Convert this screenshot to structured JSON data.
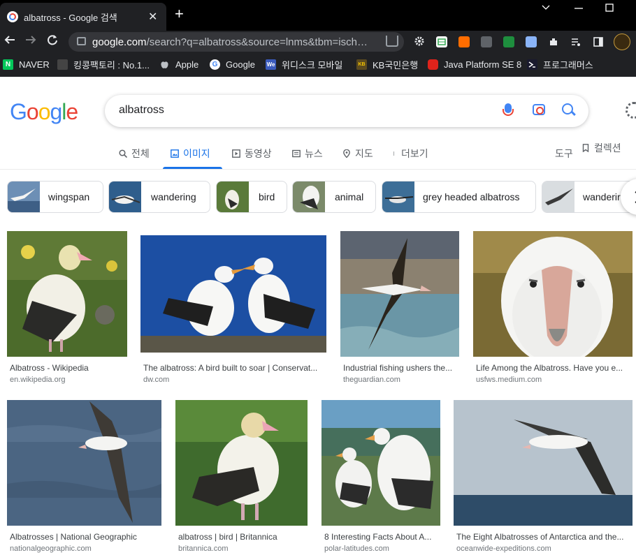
{
  "browser": {
    "tab_title": "albatross - Google 검색",
    "tab_close": "✕",
    "new_tab": "+",
    "url_host": "google.com",
    "url_rest": "/search?q=albatross&source=lnms&tbm=isch&sa...",
    "bookmarks": [
      {
        "label": "NAVER",
        "icon": "N",
        "color": "#03c75a"
      },
      {
        "label": "킹콩팩토리 : No.1...",
        "icon": "",
        "color": "#444"
      },
      {
        "label": "Apple",
        "icon": "",
        "color": "#202124"
      },
      {
        "label": "Google",
        "icon": "G",
        "color": "#ffffff"
      },
      {
        "label": "위디스크 모바일",
        "icon": "We",
        "color": "#3b5bbd"
      },
      {
        "label": "KB국민은행",
        "icon": "KB",
        "color": "#5b4a20"
      },
      {
        "label": "Java Platform SE 8",
        "icon": "",
        "color": "#e0231b"
      },
      {
        "label": "프로그래머스",
        "icon": "",
        "color": "#1a1a2e"
      }
    ]
  },
  "google": {
    "logo": [
      "G",
      "o",
      "o",
      "g",
      "l",
      "e"
    ],
    "logo_colors": [
      "#4285f4",
      "#ea4335",
      "#fbbc05",
      "#4285f4",
      "#34a853",
      "#ea4335"
    ],
    "query": "albatross",
    "nav": {
      "all": "전체",
      "images": "이미지",
      "videos": "동영상",
      "news": "뉴스",
      "maps": "지도",
      "more": "더보기",
      "tools": "도구",
      "collections": "컬렉션"
    },
    "chips": [
      "wingspan",
      "wandering",
      "bird",
      "animal",
      "grey headed albatross",
      "wanderir"
    ],
    "results": [
      {
        "title": "Albatross - Wikipedia",
        "source": "en.wikipedia.org"
      },
      {
        "title": "The albatross: A bird built to soar | Conservat...",
        "source": "dw.com"
      },
      {
        "title": "Industrial fishing ushers the...",
        "source": "theguardian.com"
      },
      {
        "title": "Life Among the Albatross. Have you e...",
        "source": "usfws.medium.com"
      },
      {
        "title": "Albatrosses | National Geographic",
        "source": "nationalgeographic.com"
      },
      {
        "title": "albatross | bird | Britannica",
        "source": "britannica.com"
      },
      {
        "title": "8 Interesting Facts About A...",
        "source": "polar-latitudes.com"
      },
      {
        "title": "The Eight Albatrosses of Antarctica and the...",
        "source": "oceanwide-expeditions.com"
      }
    ]
  },
  "colors": {
    "accent": "#1a73e8",
    "chrome_bg": "#202124",
    "tab_strip": "#000000"
  }
}
